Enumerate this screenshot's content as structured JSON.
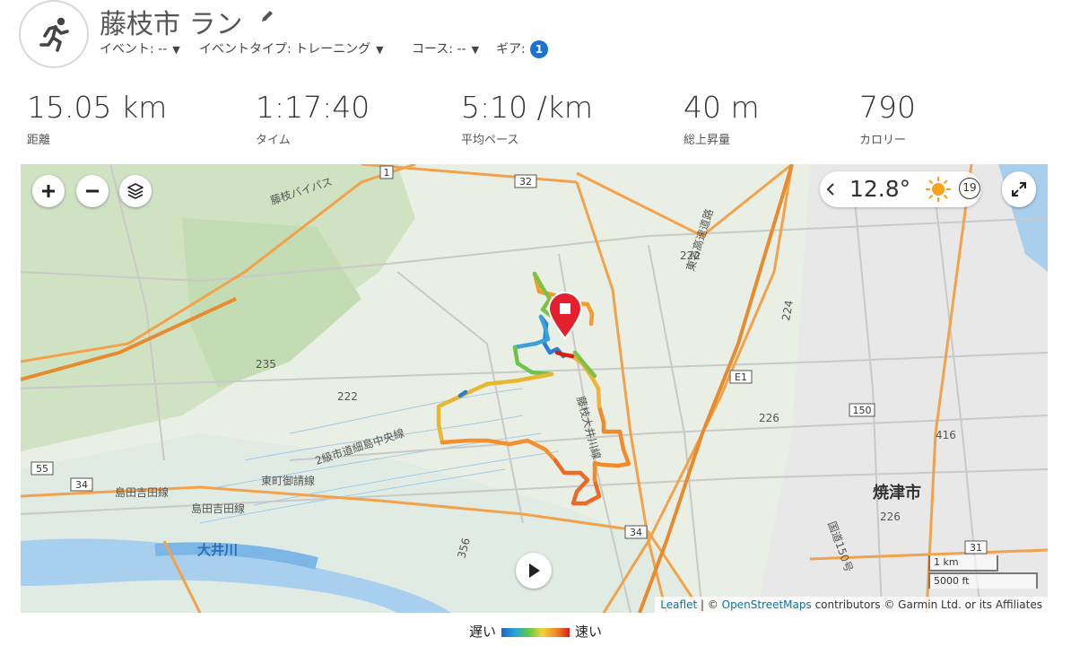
{
  "activity": {
    "icon": "running-person-icon",
    "title": "藤枝市 ラン",
    "event": "イベント: --",
    "event_type": "イベントタイプ: トレーニング",
    "course": "コース: --",
    "gear_label": "ギア:",
    "gear_count": "1"
  },
  "stats": [
    {
      "value": "15.05 km",
      "label": "距離"
    },
    {
      "value": "1:17:40",
      "label": "タイム"
    },
    {
      "value": "5:10 /km",
      "label": "平均ペース"
    },
    {
      "value": "40 m",
      "label": "総上昇量"
    },
    {
      "value": "790",
      "label": "カロリー"
    }
  ],
  "map": {
    "weather": {
      "temperature": "12.8°",
      "icon": "sun-icon",
      "wind_speed": "19"
    },
    "labels": {
      "city": "焼津市",
      "river": "大井川",
      "road_1": "藤枝バイパス",
      "road_2": "東名高速道路",
      "road_3": "島田吉田線",
      "road_4": "藤枝大井川線",
      "road_5": "東町御請線",
      "road_6": "2級市道細島中央線",
      "road_7": "島田吉田線",
      "road_8": "国道150号",
      "route_32": "32",
      "route_1": "1",
      "route_34": "34",
      "route_34b": "34",
      "route_55": "55",
      "route_150": "150",
      "route_31": "31",
      "route_e1": "E1",
      "num_222": "222",
      "num_226": "226",
      "num_235": "235",
      "num_416": "416",
      "num_224": "224",
      "num_356": "356"
    },
    "scale_km": "1 km",
    "scale_ft": "5000 ft",
    "attribution_link1": "Leaflet",
    "attribution_sep": " | © ",
    "attribution_link2": "OpenStreetMaps",
    "attribution_rest": " contributors © Garmin Ltd. or its Affiliates"
  },
  "legend": {
    "slow": "遅い",
    "fast": "速い"
  },
  "colors": {
    "accent": "#1a73d1",
    "marker": "#e4202e",
    "slow": "#1b64c8",
    "fast": "#d91e18"
  }
}
